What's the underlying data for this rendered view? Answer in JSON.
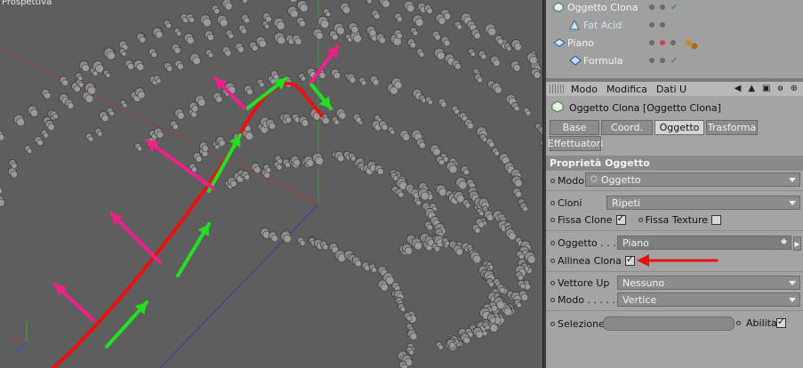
{
  "viewport": {
    "label": "Prospettiva"
  },
  "object_manager": {
    "rows": [
      {
        "label": "Oggetto Clona",
        "icon": "cloner-icon",
        "dim": false,
        "indent": 6
      },
      {
        "label": "Fat Acid",
        "icon": "molecule-icon",
        "dim": true,
        "indent": 24
      },
      {
        "label": "Piano",
        "icon": "plane-icon",
        "dim": false,
        "indent": 6
      },
      {
        "label": "Formula",
        "icon": "formula-spline-icon",
        "dim": false,
        "indent": 24
      }
    ]
  },
  "attr_menu": {
    "items": [
      "Modo",
      "Modifica",
      "Dati U"
    ]
  },
  "attr_title": "Oggetto Clona [Oggetto Clona]",
  "tabs": [
    {
      "label": "Base",
      "active": false
    },
    {
      "label": "Coord.",
      "active": false
    },
    {
      "label": "Oggetto",
      "active": true
    },
    {
      "label": "Trasforma",
      "active": false
    },
    {
      "label": "Effettuatori",
      "active": false
    }
  ],
  "section_title": "Proprietà Oggetto",
  "props": {
    "modo": {
      "label": "Modo",
      "value": "Oggetto"
    },
    "cloni": {
      "label": "Cloni",
      "value": "Ripeti"
    },
    "fissa_clone": {
      "label": "Fissa Clone",
      "checked": true
    },
    "fissa_texture": {
      "label": "Fissa Texture",
      "checked": false
    },
    "oggetto": {
      "label": "Oggetto . . .",
      "value": "Piano"
    },
    "allinea_clona": {
      "label": "Allinea Clona",
      "checked": true
    },
    "vettore_up": {
      "label": "Vettore Up",
      "value": "Nessuno"
    },
    "modo2": {
      "label": "Modo . . . . .",
      "value": "Vertice"
    },
    "selezione": {
      "label": "Selezione",
      "value": ""
    },
    "abilita": {
      "label": "Abilita",
      "checked": true
    }
  },
  "colors": {
    "annotation_red": "#e81010",
    "arrow_green": "#22e022",
    "arrow_pink": "#f0208a",
    "viewport_bg": "#5e5e5e",
    "panel_bg": "#a4a4a4"
  }
}
